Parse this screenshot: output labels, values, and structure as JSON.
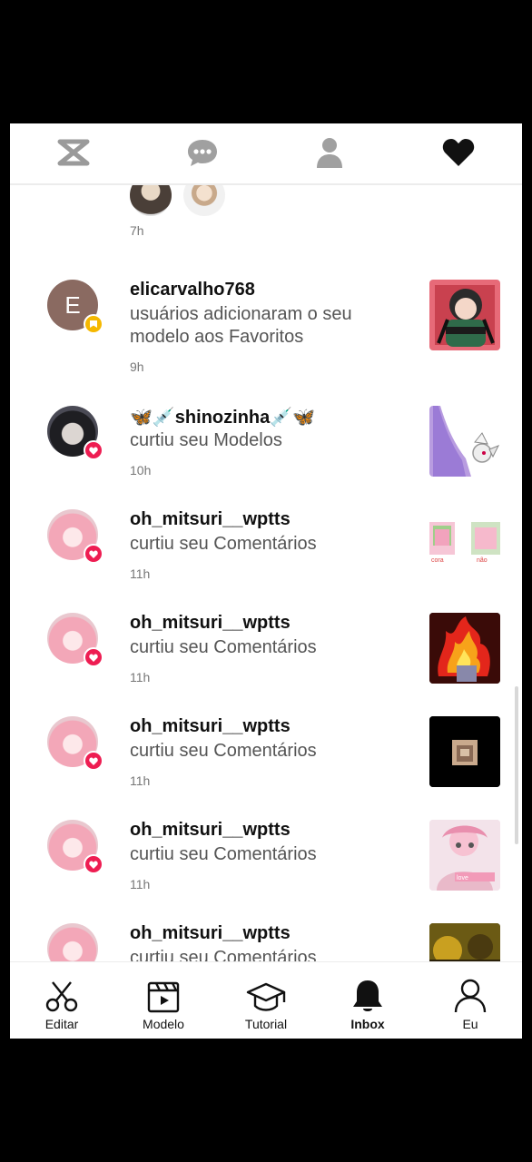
{
  "topbar": {
    "icons": [
      "capcut-logo-icon",
      "chat-bubble-icon",
      "person-icon",
      "heart-icon"
    ]
  },
  "feed": {
    "partial_top_time": "7h",
    "items": [
      {
        "username": "elicarvalho768",
        "action": " usuários adicionaram o seu modelo aos Favoritos",
        "time": "9h",
        "badge": "favorite",
        "avatar_letter": "E"
      },
      {
        "username": "🦋💉shinozinha💉🦋",
        "action": " curtiu seu Modelos",
        "time": "10h",
        "badge": "like"
      },
      {
        "username": "oh_mitsuri__wptts",
        "action": " curtiu seu Comentários",
        "time": "11h",
        "badge": "like"
      },
      {
        "username": "oh_mitsuri__wptts",
        "action": " curtiu seu Comentários",
        "time": "11h",
        "badge": "like"
      },
      {
        "username": "oh_mitsuri__wptts",
        "action": " curtiu seu Comentários",
        "time": "11h",
        "badge": "like"
      },
      {
        "username": "oh_mitsuri__wptts",
        "action": " curtiu seu Comentários",
        "time": "11h",
        "badge": "like"
      },
      {
        "username": "oh_mitsuri__wptts",
        "action": " curtiu seu Comentários",
        "time": "",
        "badge": "like"
      }
    ]
  },
  "bottom_nav": [
    {
      "label": "Editar",
      "icon": "scissors-icon"
    },
    {
      "label": "Modelo",
      "icon": "clapperboard-icon"
    },
    {
      "label": "Tutorial",
      "icon": "graduation-cap-icon"
    },
    {
      "label": "Inbox",
      "icon": "bell-icon",
      "active": true
    },
    {
      "label": "Eu",
      "icon": "profile-icon"
    }
  ],
  "colors": {
    "like_badge": "#ee1d52",
    "favorite_badge": "#f5b800",
    "text": "#111111",
    "secondary": "#555555"
  }
}
